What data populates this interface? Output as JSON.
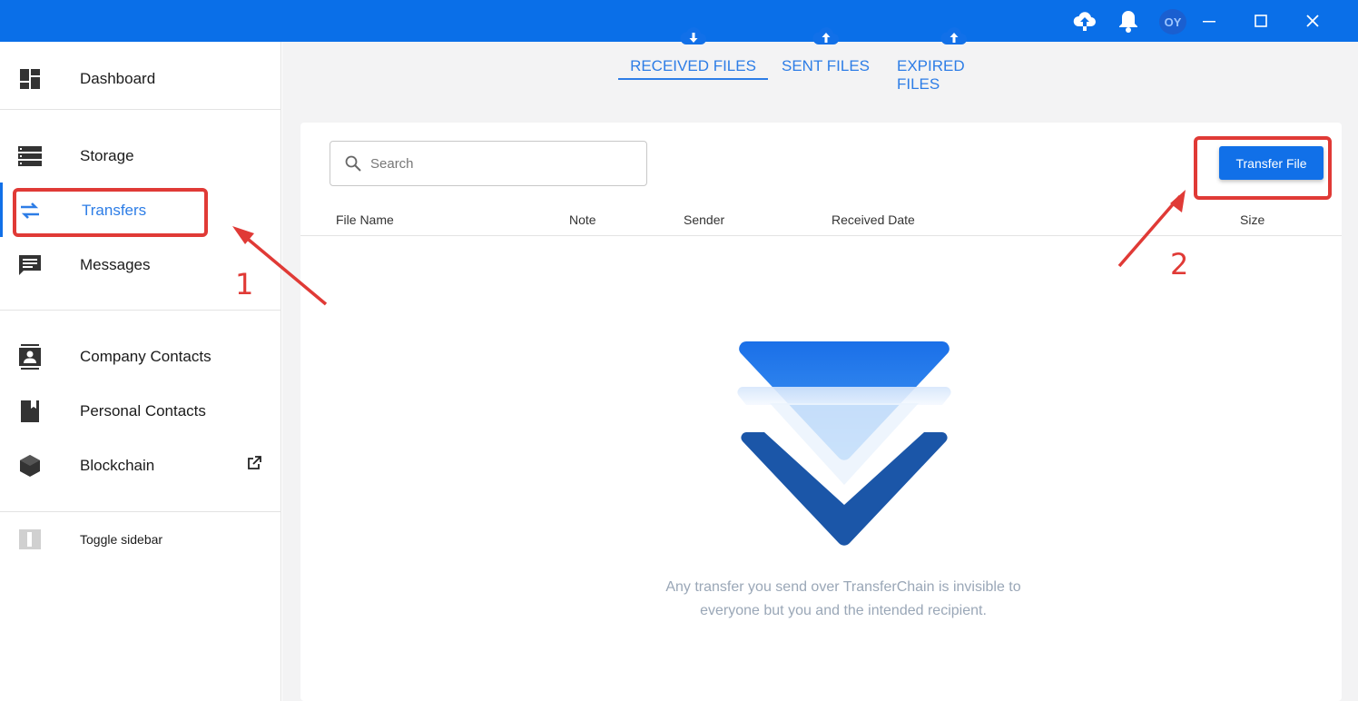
{
  "titlebar": {
    "upload_icon": "cloud-upload-icon",
    "notification_icon": "bell-icon",
    "avatar_initials": "OY",
    "minimize_icon": "minimize-icon",
    "maximize_icon": "maximize-icon",
    "close_icon": "close-icon",
    "color": "#0a6fe8"
  },
  "sidebar": {
    "items": [
      {
        "label": "Dashboard",
        "icon": "dashboard-icon"
      },
      {
        "label": "Storage",
        "icon": "storage-icon"
      },
      {
        "label": "Transfers",
        "icon": "transfer-arrows-icon",
        "active": true
      },
      {
        "label": "Messages",
        "icon": "message-icon"
      },
      {
        "label": "Company Contacts",
        "icon": "contact-card-icon"
      },
      {
        "label": "Personal Contacts",
        "icon": "contact-book-icon"
      },
      {
        "label": "Blockchain",
        "icon": "cube-icon",
        "external_icon": "external-link-icon"
      }
    ],
    "toggle": {
      "label": "Toggle sidebar",
      "icon": "sidebar-toggle-icon"
    }
  },
  "tabs": [
    {
      "label": "RECEIVED FILES",
      "icon": "cloud-download-icon",
      "active": true
    },
    {
      "label": "SENT FILES",
      "icon": "cloud-upload-icon"
    },
    {
      "label": "EXPIRED FILES",
      "icon": "cloud-upload-icon"
    }
  ],
  "search": {
    "placeholder": "Search",
    "icon": "search-icon"
  },
  "transfer_button": {
    "label": "Transfer File"
  },
  "table": {
    "columns": [
      "File Name",
      "Note",
      "Sender",
      "Received Date",
      "Size"
    ]
  },
  "empty_state": {
    "text": "Any transfer you send over TransferChain is invisible to everyone but you and the intended recipient.",
    "illustration": "transferchain-chevron-logo"
  },
  "annotations": [
    {
      "number": "1",
      "color": "#e03a36"
    },
    {
      "number": "2",
      "color": "#e03a36"
    }
  ],
  "accent_color": "#1170e8"
}
